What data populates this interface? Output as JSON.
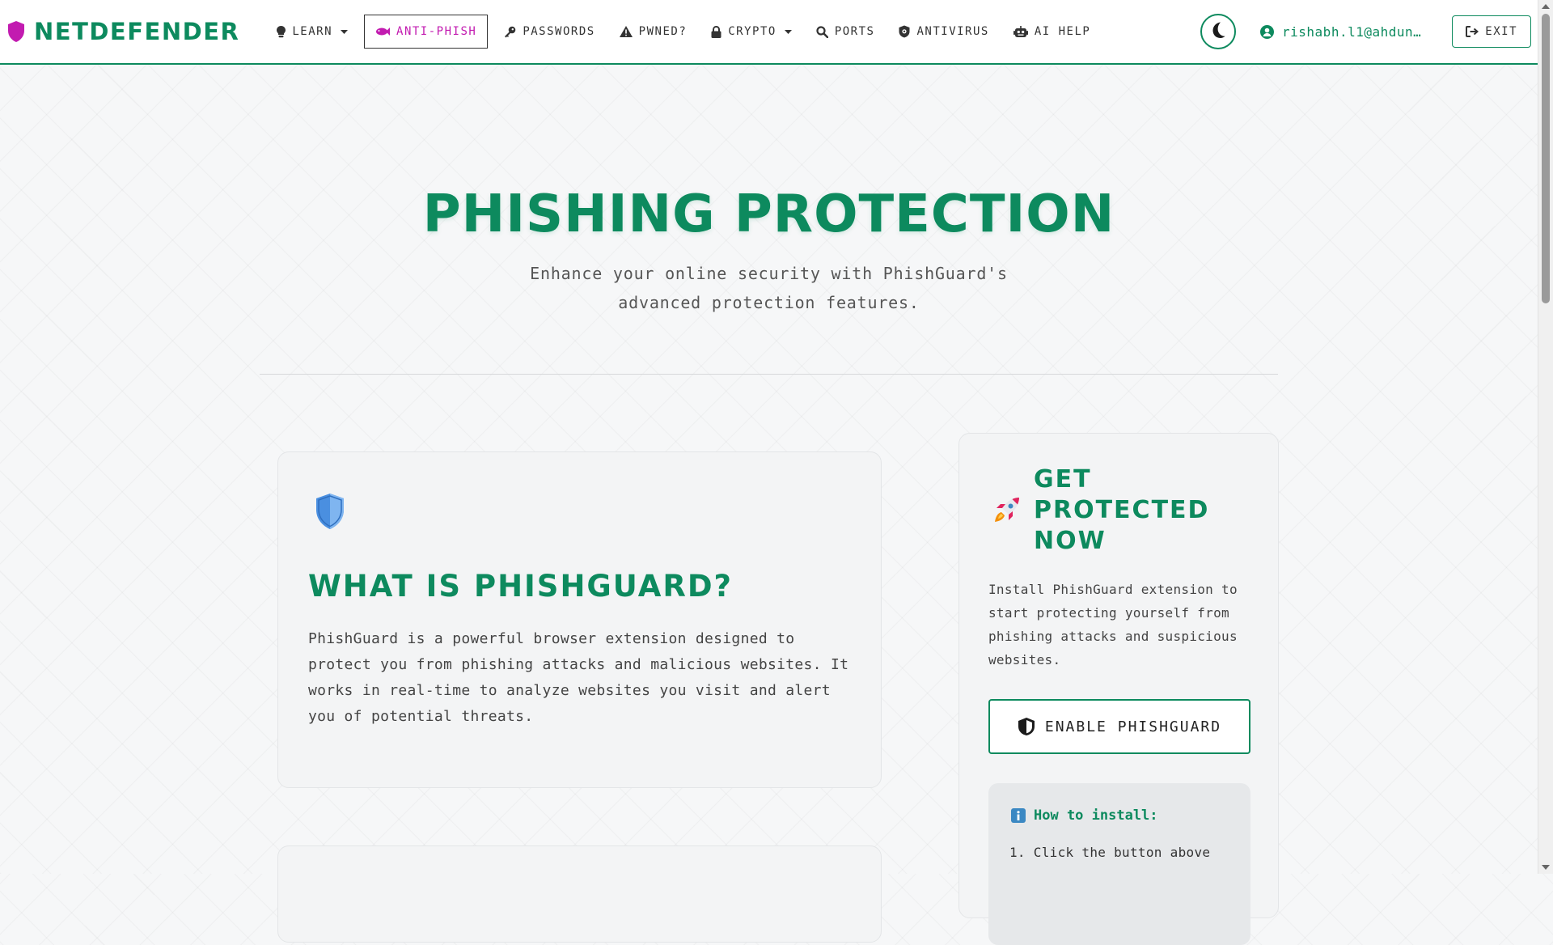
{
  "colors": {
    "accent": "#0d8a5e",
    "active": "#c21bb0",
    "brand_shield": "#c21bb0",
    "background": "#f6f7f8"
  },
  "brand": {
    "name": "NETDEFENDER",
    "icon": "shield-icon"
  },
  "nav": {
    "items": [
      {
        "label": "LEARN",
        "icon": "lightbulb-icon",
        "dropdown": true
      },
      {
        "label": "ANTI-PHISH",
        "icon": "fish-icon",
        "active": true
      },
      {
        "label": "PASSWORDS",
        "icon": "key-icon"
      },
      {
        "label": "PWNED?",
        "icon": "warning-icon"
      },
      {
        "label": "CRYPTO",
        "icon": "lock-icon",
        "dropdown": true
      },
      {
        "label": "PORTS",
        "icon": "search-icon"
      },
      {
        "label": "ANTIVIRUS",
        "icon": "shield-virus-icon"
      },
      {
        "label": "AI HELP",
        "icon": "robot-icon"
      }
    ],
    "theme_toggle_icon": "moon-icon",
    "user_email": "rishabh.l1@ahdun…",
    "exit_label": "EXIT"
  },
  "hero": {
    "title": "PHISHING PROTECTION",
    "subtitle": "Enhance your online security with PhishGuard's advanced protection features."
  },
  "main_card": {
    "icon": "shield-icon",
    "title": "WHAT IS PHISHGUARD?",
    "body": "PhishGuard is a powerful browser extension designed to protect you from phishing attacks and malicious websites. It works in real-time to analyze websites you visit and alert you of potential threats."
  },
  "side_card": {
    "icon": "rocket-icon",
    "title": "GET PROTECTED NOW",
    "body": "Install PhishGuard extension to start protecting yourself from phishing attacks and suspicious websites.",
    "button_label": "ENABLE PHISHGUARD",
    "install_title": "How to install:",
    "install_steps": [
      "1. Click the button above"
    ]
  }
}
